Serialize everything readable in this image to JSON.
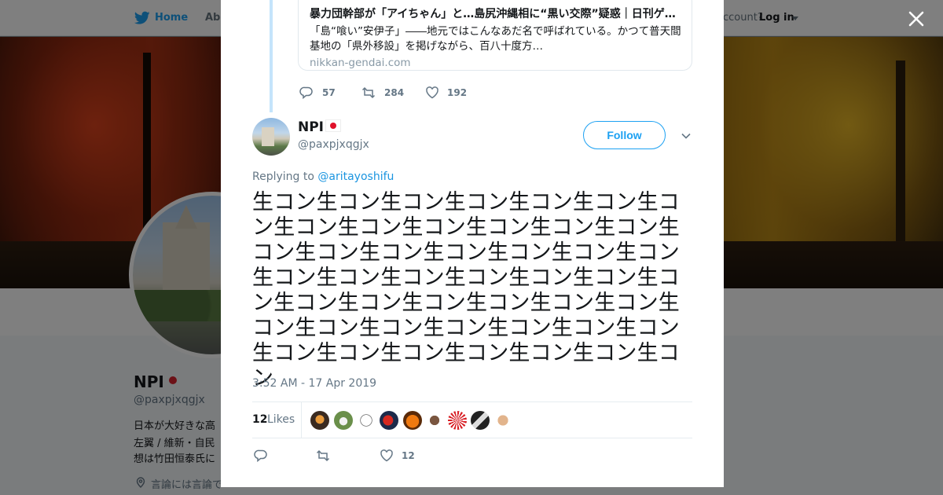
{
  "nav": {
    "home": "Home",
    "about": "Abo",
    "account_prompt": "ccount?",
    "login": "Log in"
  },
  "background_profile": {
    "name": "NPI",
    "handle": "@paxpjxqgjx",
    "bio_lines": [
      "日本が大好きな高",
      "左翼 / 維新・自民",
      "想は竹田恒泰氏に"
    ],
    "location": "言論には言論で"
  },
  "card": {
    "title": "暴力団幹部が「アイちゃん」と…島尻沖縄相に“黒い交際”疑惑｜日刊ゲ…",
    "description": "「島“喰い”安伊子」――地元ではこんなあだ名で呼ばれている。かつて普天間基地の「県外移設」を掲げながら、百八十度方…",
    "domain": "nikkan-gendai.com"
  },
  "parent_actions": {
    "replies": "57",
    "retweets": "284",
    "likes": "192"
  },
  "tweet": {
    "name": "NPI",
    "handle": "@paxpjxqgjx",
    "follow_label": "Follow",
    "replying_prefix": "Replying to ",
    "replying_to": "@aritayoshifu",
    "text": "生コン生コン生コン生コン生コン生コン生コン生コン生コン生コン生コン生コン生コン生コン生コン生コン生コン生コン生コン生コン生コン生コン生コン生コン生コン生コン生コン生コン生コン生コン生コン生コン生コン生コン生コン生コン生コン生コン生コン生コン生コン生コン生コン生コン生コン生コン生コン",
    "timestamp": "3:52 AM - 17 Apr 2019",
    "likes_count": "12",
    "likes_label": "Likes",
    "bottom_like_count": "12"
  },
  "icons": {
    "bird": "twitter-bird-icon",
    "close": "close-icon",
    "reply": "reply-icon",
    "retweet": "retweet-icon",
    "like": "heart-icon",
    "location": "location-icon",
    "chevron": "chevron-down-icon"
  },
  "colors": {
    "accent": "#1da1f2",
    "link": "#1b95e0",
    "secondary_text": "#657786",
    "thread_line": "#c4e4fb",
    "flag_red": "#e0112b"
  }
}
